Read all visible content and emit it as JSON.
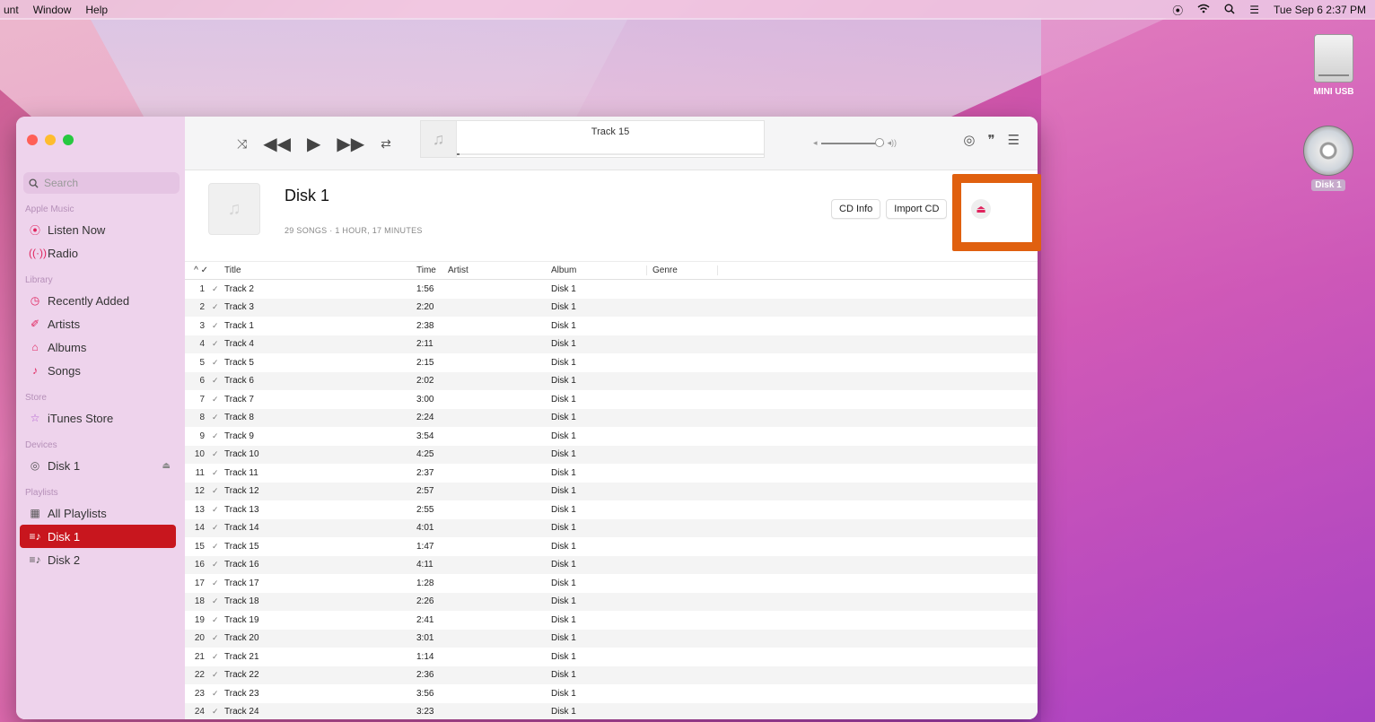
{
  "menubar": {
    "items": [
      "unt",
      "Window",
      "Help"
    ],
    "status_icons": [
      "play-circle-icon",
      "wifi-icon",
      "search-icon",
      "control-center-icon"
    ],
    "datetime": "Tue Sep 6  2:37 PM"
  },
  "desktop": {
    "icons": [
      {
        "label": "MINI USB",
        "icon": "usb-drive-icon"
      },
      {
        "label": "Disk 1",
        "icon": "cd-icon"
      }
    ]
  },
  "sidebar": {
    "search_placeholder": "Search",
    "sections": {
      "apple_music": "Apple Music",
      "library": "Library",
      "store": "Store",
      "devices": "Devices",
      "playlists": "Playlists"
    },
    "apple_music_items": [
      {
        "label": "Listen Now",
        "icon": "play-circle-icon"
      },
      {
        "label": "Radio",
        "icon": "radio-icon"
      }
    ],
    "library_items": [
      {
        "label": "Recently Added",
        "icon": "clock-icon"
      },
      {
        "label": "Artists",
        "icon": "microphone-icon"
      },
      {
        "label": "Albums",
        "icon": "album-icon"
      },
      {
        "label": "Songs",
        "icon": "note-icon"
      }
    ],
    "store_items": [
      {
        "label": "iTunes Store",
        "icon": "star-icon"
      }
    ],
    "device_items": [
      {
        "label": "Disk 1",
        "icon": "cd-icon"
      }
    ],
    "playlist_items": [
      {
        "label": "All Playlists",
        "icon": "grid-icon"
      },
      {
        "label": "Disk 1",
        "icon": "playlist-icon",
        "active": true
      },
      {
        "label": "Disk 2",
        "icon": "playlist-icon"
      }
    ]
  },
  "toolbar": {
    "now_playing": "Track 15",
    "progress": 0.01
  },
  "header": {
    "title": "Disk 1",
    "subtitle": "29 SONGS · 1 HOUR, 17 MINUTES",
    "cd_info_label": "CD Info",
    "import_label": "Import CD"
  },
  "table": {
    "columns": {
      "sort": "^ ✓",
      "title": "Title",
      "time": "Time",
      "artist": "Artist",
      "album": "Album",
      "genre": "Genre"
    },
    "rows": [
      {
        "n": "1",
        "title": "Track 2",
        "time": "1:56",
        "album": "Disk 1"
      },
      {
        "n": "2",
        "title": "Track 3",
        "time": "2:20",
        "album": "Disk 1"
      },
      {
        "n": "3",
        "title": "Track 1",
        "time": "2:38",
        "album": "Disk 1"
      },
      {
        "n": "4",
        "title": "Track 4",
        "time": "2:11",
        "album": "Disk 1"
      },
      {
        "n": "5",
        "title": "Track 5",
        "time": "2:15",
        "album": "Disk 1"
      },
      {
        "n": "6",
        "title": "Track 6",
        "time": "2:02",
        "album": "Disk 1"
      },
      {
        "n": "7",
        "title": "Track 7",
        "time": "3:00",
        "album": "Disk 1"
      },
      {
        "n": "8",
        "title": "Track 8",
        "time": "2:24",
        "album": "Disk 1"
      },
      {
        "n": "9",
        "title": "Track 9",
        "time": "3:54",
        "album": "Disk 1"
      },
      {
        "n": "10",
        "title": "Track 10",
        "time": "4:25",
        "album": "Disk 1"
      },
      {
        "n": "11",
        "title": "Track 11",
        "time": "2:37",
        "album": "Disk 1"
      },
      {
        "n": "12",
        "title": "Track 12",
        "time": "2:57",
        "album": "Disk 1"
      },
      {
        "n": "13",
        "title": "Track 13",
        "time": "2:55",
        "album": "Disk 1"
      },
      {
        "n": "14",
        "title": "Track 14",
        "time": "4:01",
        "album": "Disk 1"
      },
      {
        "n": "15",
        "title": "Track 15",
        "time": "1:47",
        "album": "Disk 1"
      },
      {
        "n": "16",
        "title": "Track 16",
        "time": "4:11",
        "album": "Disk 1"
      },
      {
        "n": "17",
        "title": "Track 17",
        "time": "1:28",
        "album": "Disk 1"
      },
      {
        "n": "18",
        "title": "Track 18",
        "time": "2:26",
        "album": "Disk 1"
      },
      {
        "n": "19",
        "title": "Track 19",
        "time": "2:41",
        "album": "Disk 1"
      },
      {
        "n": "20",
        "title": "Track 20",
        "time": "3:01",
        "album": "Disk 1"
      },
      {
        "n": "21",
        "title": "Track 21",
        "time": "1:14",
        "album": "Disk 1"
      },
      {
        "n": "22",
        "title": "Track 22",
        "time": "2:36",
        "album": "Disk 1"
      },
      {
        "n": "23",
        "title": "Track 23",
        "time": "3:56",
        "album": "Disk 1"
      },
      {
        "n": "24",
        "title": "Track 24",
        "time": "3:23",
        "album": "Disk 1"
      }
    ]
  },
  "colors": {
    "accent": "#e0245e",
    "active_item": "#c8161e",
    "annotation": "#e0600f"
  }
}
